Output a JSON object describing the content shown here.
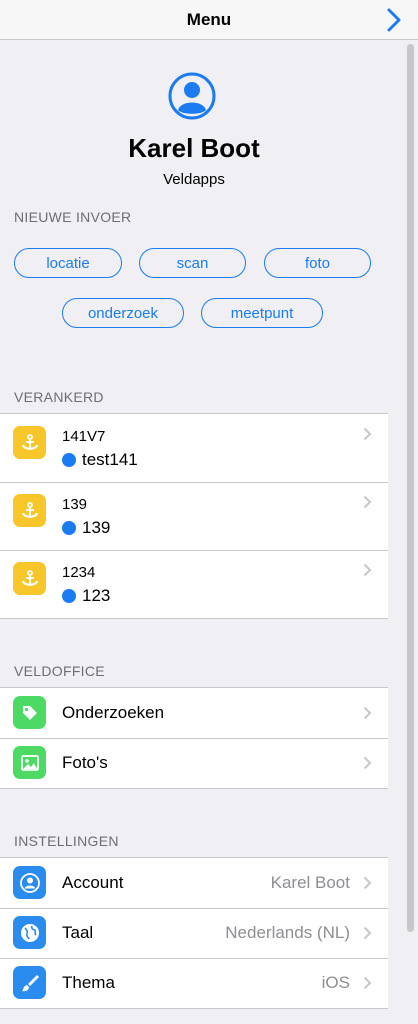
{
  "navbar": {
    "title": "Menu",
    "forward_icon": "chevron-right-icon"
  },
  "profile": {
    "name": "Karel Boot",
    "organization": "Veldapps",
    "avatar_icon": "person-circle-icon"
  },
  "new_entry": {
    "header": "NIEUWE INVOER",
    "buttons": [
      "locatie",
      "scan",
      "foto",
      "onderzoek",
      "meetpunt"
    ]
  },
  "anchored": {
    "header": "VERANKERD",
    "items": [
      {
        "code": "141V7",
        "name": "test141"
      },
      {
        "code": "139",
        "name": "139"
      },
      {
        "code": "1234",
        "name": "123"
      }
    ]
  },
  "veldoffice": {
    "header": "VELDOFFICE",
    "items": [
      {
        "label": "Onderzoeken",
        "icon": "tag-icon"
      },
      {
        "label": "Foto's",
        "icon": "photo-icon"
      }
    ]
  },
  "settings": {
    "header": "INSTELLINGEN",
    "items": [
      {
        "label": "Account",
        "value": "Karel Boot",
        "icon": "person-icon"
      },
      {
        "label": "Taal",
        "value": "Nederlands (NL)",
        "icon": "globe-icon"
      },
      {
        "label": "Thema",
        "value": "iOS",
        "icon": "brush-icon"
      }
    ]
  },
  "colors": {
    "accent": "#1a7cf0",
    "anchor": "#f7c62b",
    "green": "#4cd964",
    "blue_icon": "#2b8cf0"
  }
}
